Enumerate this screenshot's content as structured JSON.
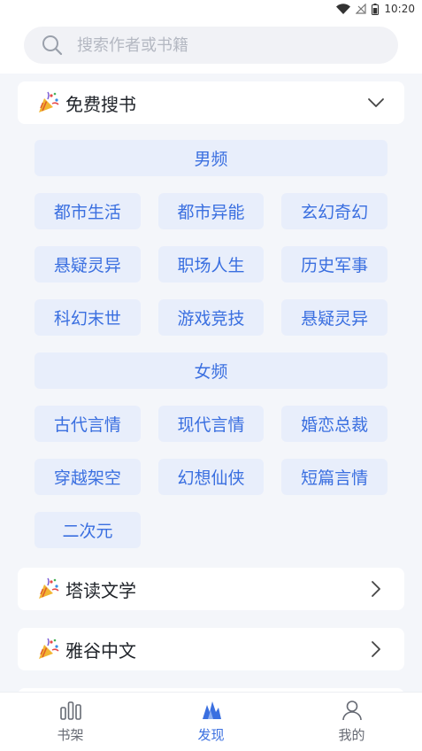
{
  "status_bar": {
    "time": "10:20"
  },
  "search": {
    "placeholder": "搜索作者或书籍"
  },
  "sections": {
    "free": {
      "title": "免费搜书"
    },
    "tadu": {
      "title": "塔读文学"
    },
    "yagu": {
      "title": "雅谷中文"
    }
  },
  "categories": {
    "male": {
      "label": "男频",
      "rows": [
        [
          "都市生活",
          "都市异能",
          "玄幻奇幻"
        ],
        [
          "悬疑灵异",
          "职场人生",
          "历史军事"
        ],
        [
          "科幻末世",
          "游戏竞技",
          "悬疑灵异"
        ]
      ]
    },
    "female": {
      "label": "女频",
      "rows": [
        [
          "古代言情",
          "现代言情",
          "婚恋总裁"
        ],
        [
          "穿越架空",
          "幻想仙侠",
          "短篇言情"
        ],
        [
          "二次元"
        ]
      ]
    }
  },
  "bottom_nav": {
    "items": [
      {
        "label": "书架",
        "icon": "bookshelf-icon",
        "active": false
      },
      {
        "label": "发现",
        "icon": "discover-icon",
        "active": true
      },
      {
        "label": "我的",
        "icon": "profile-icon",
        "active": false
      }
    ]
  },
  "colors": {
    "accent": "#3a6fe0",
    "chip_bg": "#e8eefb",
    "page_bg": "#f4f6fa"
  }
}
